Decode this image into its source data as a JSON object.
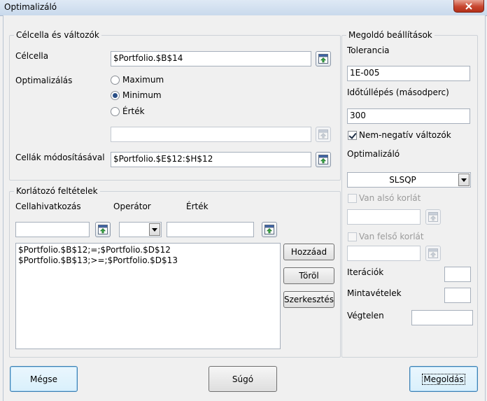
{
  "window": {
    "title": "Optimalizáló"
  },
  "left_group": {
    "title": "Célcella és változók",
    "target_label": "Célcella",
    "target_value": "$Portfolio.$B$14",
    "optimize_label": "Optimalizálás",
    "radio_max": "Maximum",
    "radio_min": "Minimum",
    "radio_value": "Érték",
    "value_input": "",
    "changing_label": "Cellák módosításával",
    "changing_value": "$Portfolio.$E$12:$H$12"
  },
  "constraints": {
    "title": "Korlátozó feltételek",
    "col_cell": "Cellahivatkozás",
    "col_operator": "Operátor",
    "col_value": "Érték",
    "cell_input": "",
    "value_input": "",
    "operator_value": "",
    "items": [
      "$Portfolio.$B$12;=;$Portfolio.$D$12",
      "$Portfolio.$B$13;>=;$Portfolio.$D$13"
    ],
    "add_button": "Hozzáad",
    "delete_button": "Töröl",
    "edit_button": "Szerkesztés"
  },
  "settings": {
    "title": "Megoldó beállítások",
    "tolerance_label": "Tolerancia",
    "tolerance_value": "1E-005",
    "timeout_label": "Időtúllépés (másodperc)",
    "timeout_value": "300",
    "nonneg_label": "Nem-negatív változók",
    "optimizer_label": "Optimalizáló",
    "optimizer_value": "SLSQP",
    "lower_label": "Van alsó korlát",
    "lower_value": "",
    "upper_label": "Van felső korlát",
    "upper_value": "",
    "iterations_label": "Iterációk",
    "iterations_value": "",
    "samples_label": "Mintavételek",
    "samples_value": "",
    "infinity_label": "Végtelen",
    "infinity_value": ""
  },
  "footer": {
    "cancel": "Mégse",
    "help": "Súgó",
    "solve": "Megoldás"
  }
}
